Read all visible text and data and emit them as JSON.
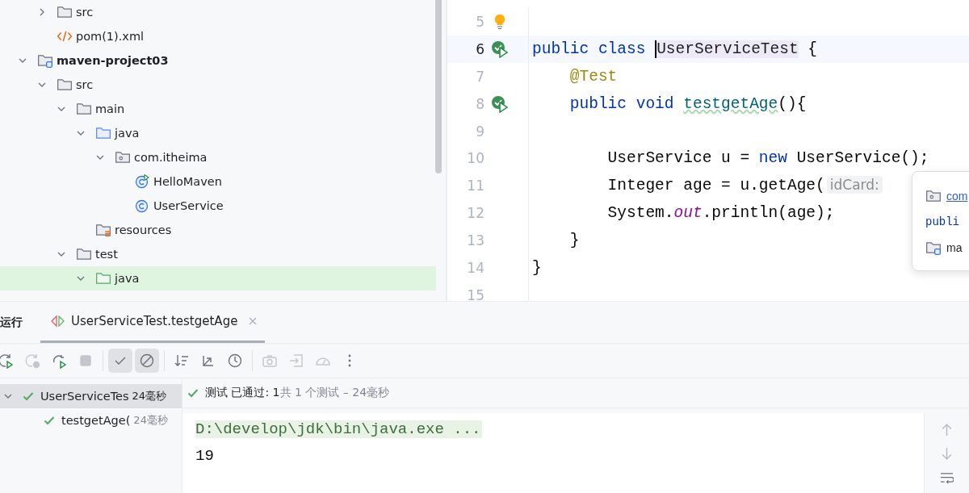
{
  "project_tree": {
    "continued": [
      {
        "label": "src",
        "kind": "folder",
        "expanded": false,
        "selected": false
      },
      {
        "label": "pom(1).xml",
        "kind": "xml",
        "selected": false
      }
    ],
    "items": [
      {
        "label": "maven-project03",
        "kind": "module",
        "bold": true,
        "expanded": true,
        "selected": false,
        "children": [
          {
            "label": "src",
            "kind": "folder",
            "expanded": true,
            "selected": false,
            "children": [
              {
                "label": "main",
                "kind": "folder",
                "expanded": true,
                "selected": false,
                "children": [
                  {
                    "label": "java",
                    "kind": "source-folder",
                    "expanded": true,
                    "selected": false,
                    "children": [
                      {
                        "label": "com.itheima",
                        "kind": "package",
                        "expanded": true,
                        "selected": false,
                        "children": [
                          {
                            "label": "HelloMaven",
                            "kind": "runnable-class",
                            "selected": false
                          },
                          {
                            "label": "UserService",
                            "kind": "class",
                            "selected": false
                          }
                        ]
                      }
                    ]
                  },
                  {
                    "label": "resources",
                    "kind": "resources",
                    "selected": false
                  }
                ]
              },
              {
                "label": "test",
                "kind": "folder",
                "expanded": true,
                "selected": false,
                "children": [
                  {
                    "label": "java",
                    "kind": "test-folder",
                    "expanded": true,
                    "selected": true
                  }
                ]
              }
            ]
          }
        ]
      }
    ]
  },
  "editor": {
    "lines": [
      {
        "number": "5",
        "kind": "bulb",
        "current": false
      },
      {
        "number": "6",
        "kind": "run-passed",
        "current": true,
        "tokens": [
          {
            "text": "public class ",
            "kind": "keyword"
          },
          {
            "text": "UserServiceTest",
            "kind": "caret-highlight"
          },
          {
            "text": " {",
            "kind": "plain"
          }
        ]
      },
      {
        "number": "7",
        "kind": "plain",
        "current": false,
        "tokens": [
          {
            "text": "    @Test",
            "kind": "annotation"
          }
        ]
      },
      {
        "number": "8",
        "kind": "run-passed",
        "current": false,
        "tokens": [
          {
            "text": "    public void ",
            "kind": "keyword"
          },
          {
            "text": "testgetAge",
            "kind": "method-warning"
          },
          {
            "text": "(){",
            "kind": "plain"
          }
        ]
      },
      {
        "number": "9",
        "kind": "plain",
        "current": false
      },
      {
        "number": "10",
        "kind": "plain",
        "current": false,
        "tokens": [
          {
            "text": "        UserService u = ",
            "kind": "plain"
          },
          {
            "text": "new",
            "kind": "keyword"
          },
          {
            "text": " UserService();",
            "kind": "plain"
          }
        ]
      },
      {
        "number": "11",
        "kind": "plain",
        "current": false,
        "tokens": [
          {
            "text": "        Integer age = u.getAge(",
            "kind": "plain"
          },
          {
            "text": "idCard:",
            "kind": "hint"
          }
        ]
      },
      {
        "number": "12",
        "kind": "plain",
        "current": false,
        "tokens": [
          {
            "text": "        System.",
            "kind": "plain"
          },
          {
            "text": "out",
            "kind": "static"
          },
          {
            "text": ".println(age);",
            "kind": "plain"
          }
        ]
      },
      {
        "number": "13",
        "kind": "plain",
        "current": false,
        "tokens": [
          {
            "text": "    }",
            "kind": "plain"
          }
        ]
      },
      {
        "number": "14",
        "kind": "plain",
        "current": false,
        "tokens": [
          {
            "text": "}",
            "kind": "plain"
          }
        ]
      },
      {
        "number": "15",
        "kind": "plain",
        "current": false
      }
    ],
    "popup": {
      "package": "com",
      "declaration": "publi",
      "module": "ma"
    }
  },
  "run_panel": {
    "title": "运行",
    "tab": {
      "label": "UserServiceTest.testgetAge",
      "selected": true
    },
    "toolbar": [
      {
        "kind": "rerun",
        "disabled": false,
        "on": false
      },
      {
        "kind": "rerun-failed",
        "disabled": true,
        "on": false
      },
      {
        "kind": "auto-rerun",
        "disabled": false,
        "on": false
      },
      {
        "kind": "stop",
        "disabled": true,
        "on": false
      },
      {
        "kind": "separator"
      },
      {
        "kind": "show-passed",
        "disabled": false,
        "on": true
      },
      {
        "kind": "show-ignored",
        "disabled": false,
        "on": true
      },
      {
        "kind": "separator"
      },
      {
        "kind": "sort",
        "disabled": false,
        "on": false
      },
      {
        "kind": "collapse",
        "disabled": false,
        "on": false
      },
      {
        "kind": "history",
        "disabled": false,
        "on": false
      },
      {
        "kind": "separator"
      },
      {
        "kind": "snapshot",
        "disabled": true,
        "on": false
      },
      {
        "kind": "import",
        "disabled": true,
        "on": false
      },
      {
        "kind": "coverage",
        "disabled": true,
        "on": false
      },
      {
        "kind": "more",
        "disabled": false,
        "on": false
      }
    ],
    "tests": [
      {
        "name": "UserServiceTes",
        "time": "24毫秒",
        "selected": true,
        "children": [
          {
            "name": "testgetAge(",
            "time": "24毫秒",
            "selected": false
          }
        ]
      }
    ],
    "status": {
      "label": "测试 已通过: 1",
      "summary": "共 1 个测试 – 24毫秒"
    },
    "console": [
      {
        "text": "D:\\develop\\jdk\\bin\\java.exe ...",
        "kind": "command"
      },
      {
        "text": "19",
        "kind": "output"
      }
    ]
  }
}
